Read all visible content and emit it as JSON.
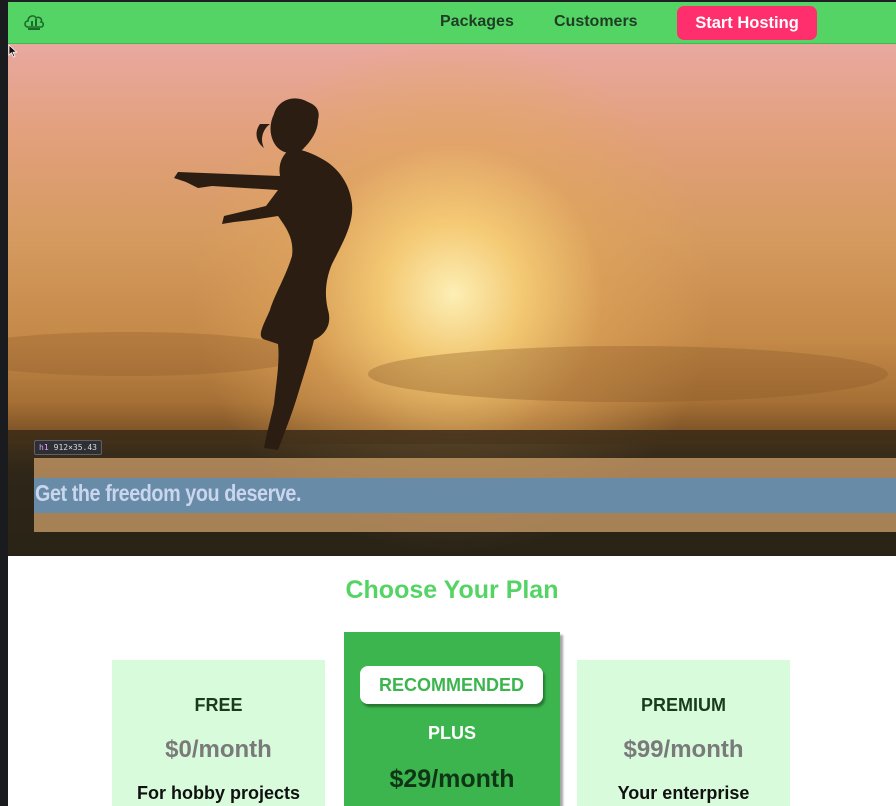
{
  "navbar": {
    "links": [
      "Packages",
      "Customers"
    ],
    "cta_label": "Start Hosting",
    "logo_icon": "cloud-hosting-logo-icon",
    "colors": {
      "nav_bg": "#55d466",
      "cta_bg": "#ff2f6d"
    }
  },
  "hero": {
    "title": "Get the freedom you deserve.",
    "devtools_tag": {
      "element": "h1",
      "size": "912×35.43"
    }
  },
  "plans": {
    "section_title": "Choose Your Plan",
    "cards": [
      {
        "name": "FREE",
        "price": "$0/month",
        "description": "For hobby projects"
      },
      {
        "badge": "RECOMMENDED",
        "name": "PLUS",
        "price": "$29/month"
      },
      {
        "name": "PREMIUM",
        "price": "$99/month",
        "description": "Your enterprise"
      }
    ],
    "colors": {
      "title": "#55d466",
      "card_bg": "#d8fbdb",
      "recommended_bg": "#3cb54e"
    }
  }
}
